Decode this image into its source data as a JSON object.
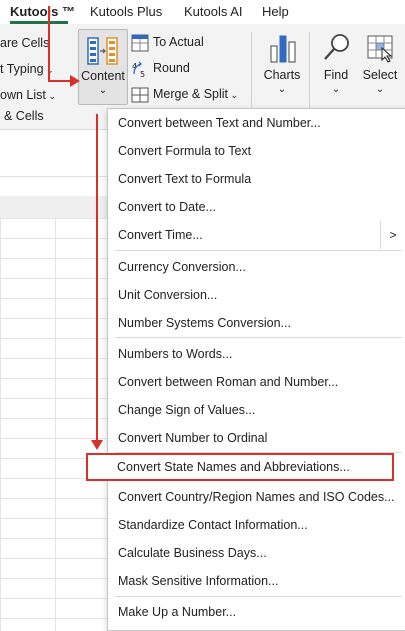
{
  "tabs": [
    {
      "label": "Kutools ™",
      "active": true
    },
    {
      "label": "Kutools Plus",
      "active": false
    },
    {
      "label": "Kutools AI",
      "active": false
    },
    {
      "label": "Help",
      "active": false
    }
  ],
  "ribbon": {
    "left_items": [
      "are Cells",
      "t Typing",
      "own List",
      "& Cells"
    ],
    "content_button": {
      "label": "Content",
      "icon": "content-icon"
    },
    "small_buttons": [
      {
        "label": "To Actual",
        "icon": "to-actual-icon"
      },
      {
        "label": "Round",
        "icon": "round-icon"
      },
      {
        "label": "Merge & Split",
        "icon": "merge-split-icon"
      }
    ],
    "big_buttons": [
      {
        "label": "Charts",
        "icon": "charts-icon"
      },
      {
        "label": "Find",
        "icon": "find-icon"
      },
      {
        "label": "Select",
        "icon": "select-icon"
      }
    ]
  },
  "menu": {
    "groups": [
      [
        "Convert between Text and Number...",
        "Convert Formula to Text",
        "Convert Text to Formula",
        "Convert to Date...",
        "Convert Time..."
      ],
      [
        "Currency Conversion...",
        "Unit Conversion...",
        "Number Systems Conversion..."
      ],
      [
        "Numbers to Words...",
        "Convert between Roman and Number...",
        "Change Sign of Values...",
        "Convert Number to Ordinal"
      ],
      [
        "Convert State Names and Abbreviations...",
        "Convert Country/Region Names and ISO Codes...",
        "Standardize Contact Information...",
        "Calculate Business Days...",
        "Mask Sensitive Information..."
      ],
      [
        "Make Up a Number..."
      ]
    ],
    "highlighted": "Convert State Names and Abbreviations...",
    "accent_color": "#d9302c"
  }
}
